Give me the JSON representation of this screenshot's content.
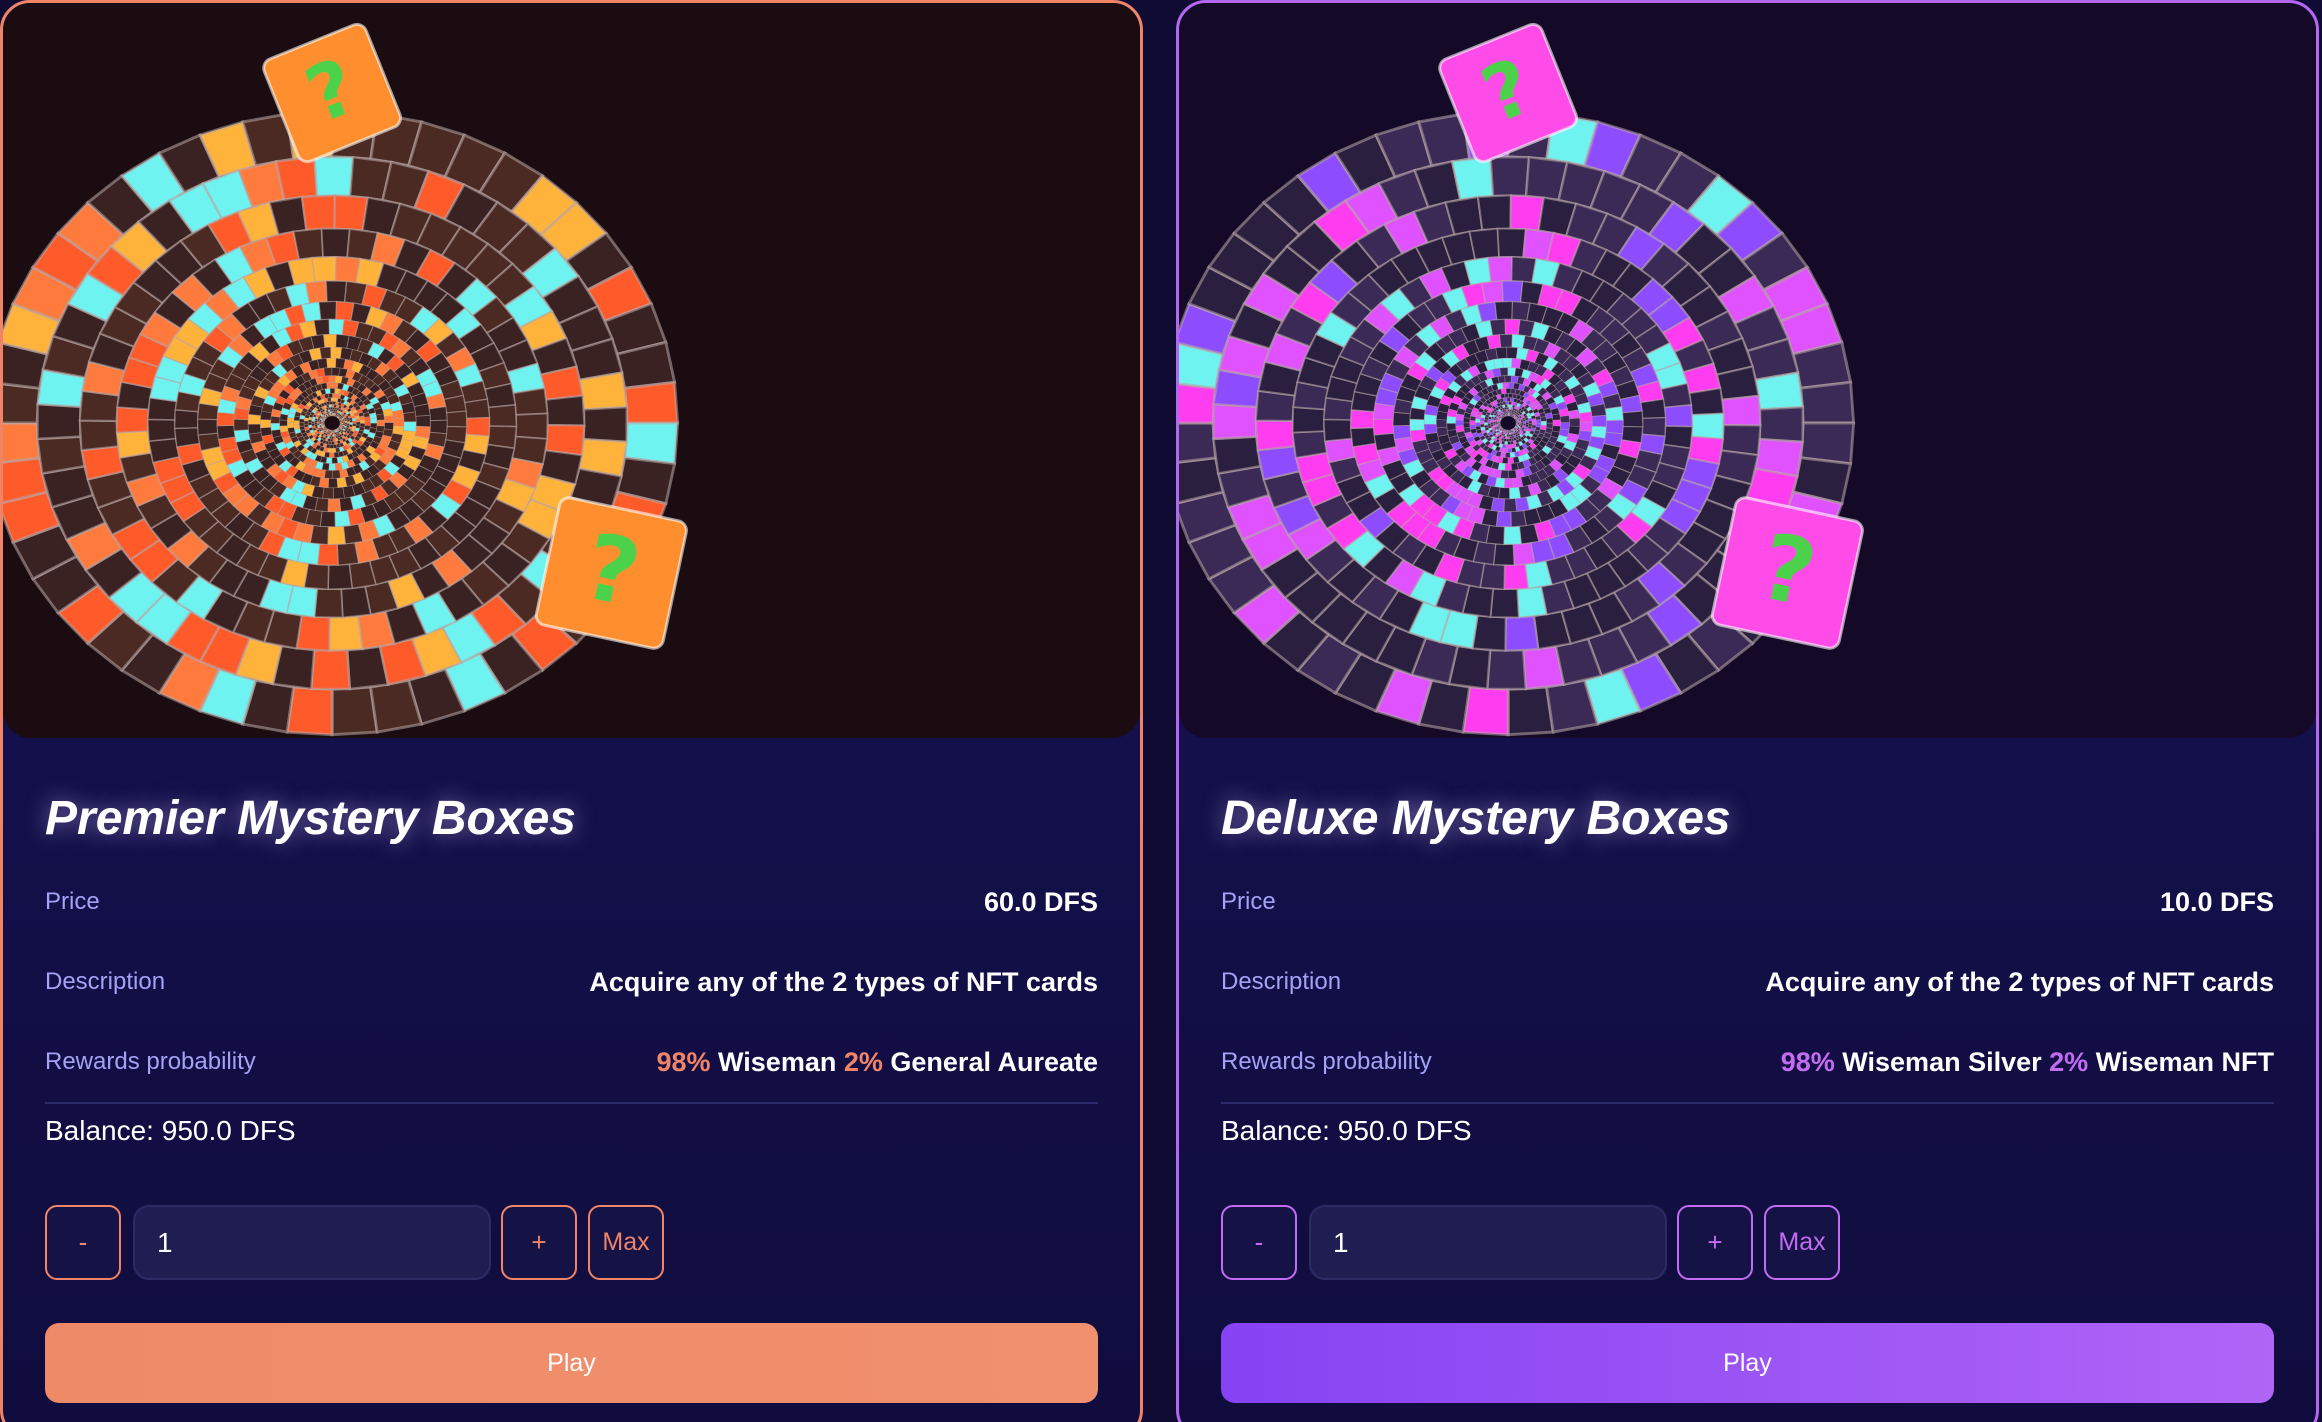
{
  "cards": [
    {
      "title": "Premier Mystery Boxes",
      "price_label": "Price",
      "price_value": "60.0 DFS",
      "description_label": "Description",
      "description_value": "Acquire any of the 2 types of NFT cards",
      "rewards_label": "Rewards probability",
      "rewards": [
        {
          "percent": "98%",
          "name": "Wiseman"
        },
        {
          "percent": "2%",
          "name": "General Aureate"
        }
      ],
      "balance": "Balance: 950.0 DFS",
      "quantity": "1",
      "minus_label": "-",
      "plus_label": "+",
      "max_label": "Max",
      "play_label": "Play",
      "accent_color": "#ef8466",
      "theme": "orange"
    },
    {
      "title": "Deluxe Mystery Boxes",
      "price_label": "Price",
      "price_value": "10.0 DFS",
      "description_label": "Description",
      "description_value": "Acquire any of the 2 types of NFT cards",
      "rewards_label": "Rewards probability",
      "rewards": [
        {
          "percent": "98%",
          "name": "Wiseman Silver"
        },
        {
          "percent": "2%",
          "name": "Wiseman NFT"
        }
      ],
      "balance": "Balance: 950.0 DFS",
      "quantity": "1",
      "minus_label": "-",
      "plus_label": "+",
      "max_label": "Max",
      "play_label": "Play",
      "accent_color": "#c36cf2",
      "theme": "purple"
    }
  ]
}
